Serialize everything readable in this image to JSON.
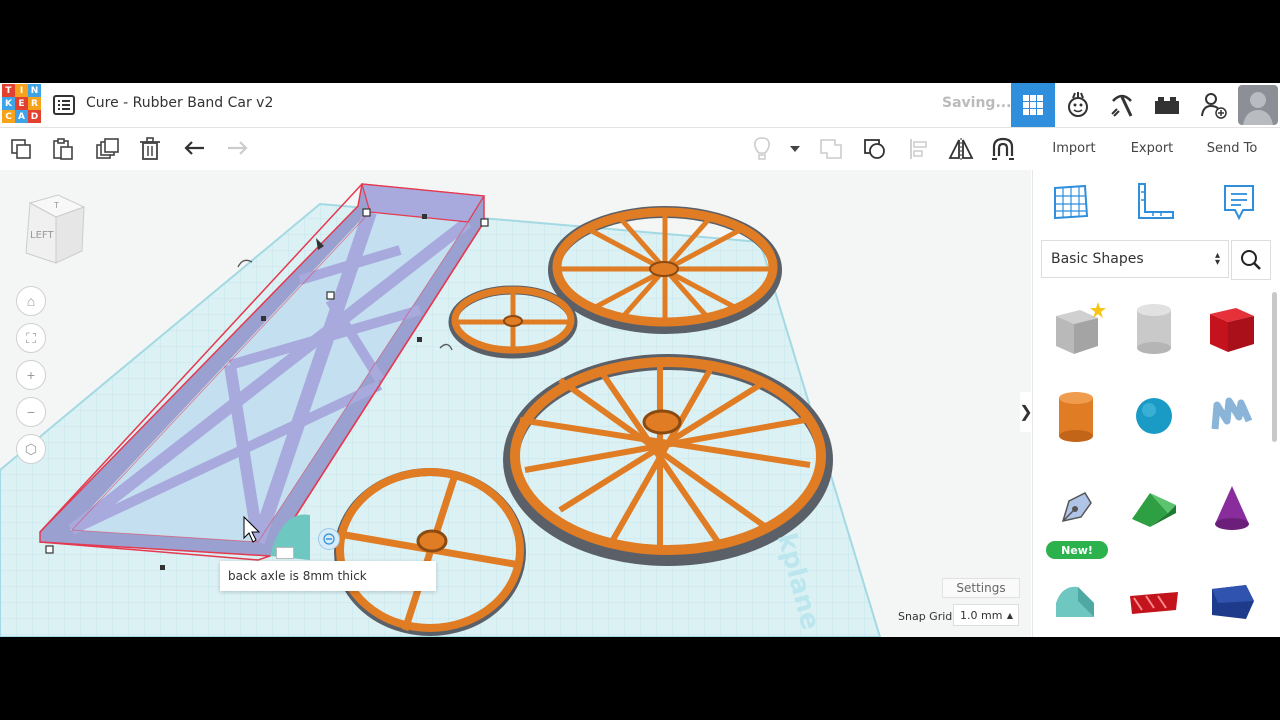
{
  "logo": {
    "letters": [
      "T",
      "I",
      "N",
      "K",
      "E",
      "R",
      "C",
      "A",
      "D"
    ],
    "colors": [
      "#e2412f",
      "#f7a21b",
      "#3fa3e8",
      "#3fa3e8",
      "#e2412f",
      "#f7a21b",
      "#f7a21b",
      "#3fa3e8",
      "#e2412f"
    ]
  },
  "header": {
    "title": "Cure - Rubber Band Car v2",
    "status": "Saving..."
  },
  "toolbar": {
    "import": "Import",
    "export": "Export",
    "send_to": "Send To"
  },
  "viewcube": {
    "face": "LEFT"
  },
  "panel": {
    "category": "Basic Shapes",
    "new_badge": "New!"
  },
  "tooltip": {
    "text": "back axle is 8mm thick"
  },
  "footer": {
    "settings": "Settings",
    "snap_label": "Snap Grid",
    "snap_value": "1.0 mm"
  },
  "workplane_text": "kplane",
  "colors": {
    "accent": "#2f8fdd",
    "orange": "#e07c24",
    "frame": "#a8a9dc",
    "select_red": "#e53950"
  }
}
